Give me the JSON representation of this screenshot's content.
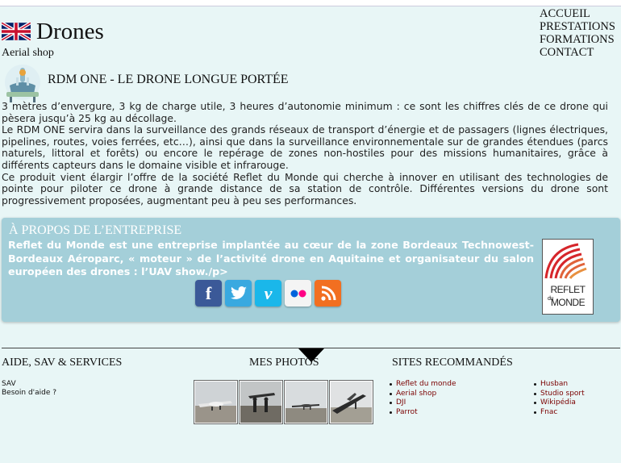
{
  "header": {
    "flag_icon": "uk-flag-icon",
    "title": "Drones",
    "tagline": "Aerial shop"
  },
  "nav": {
    "items": [
      "ACCUEIL",
      "PRESTATIONS",
      "FORMATIONS",
      "CONTACT"
    ]
  },
  "article": {
    "icon": "drone-icon",
    "title": "RDM ONE - LE DRONE LONGUE PORTÉE",
    "paragraphs": [
      "3 mètres d’envergure, 3 kg de charge utile, 3 heures d’autonomie minimum : ce sont les chiffres clés de ce drone qui pèsera jusqu’à 25 kg au décollage.",
      "Le RDM ONE servira dans la surveillance des grands réseaux de transport d’énergie et de passagers (lignes électriques, pipelines, routes, voies ferrées, etc…), ainsi que dans la surveillance environnementale sur de grandes étendues (parcs naturels, littoral et forêts) ou encore le repérage de zones non-hostiles pour des missions humanitaires, grâce à différents capteurs dans le domaine visible et infrarouge.",
      "Ce produit vient élargir l’offre de la société Reflet du Monde qui cherche à innover en utilisant des technologies de pointe pour piloter ce drone à grande distance de sa station de contrôle. Différentes versions du drone sont progressivement proposées, augmentant peu à peu ses performances."
    ]
  },
  "about": {
    "title": "À PROPOS DE L’ENTREPRISE",
    "text": "Reflet du Monde est une entreprise implantée au cœur de la zone Bordeaux Technowest-Bordeaux Aéroparc, « moteur » de l’activité drone en Aquitaine et organisateur du salon européen des drones : l’UAV show./p>",
    "socials": [
      {
        "icon": "facebook-icon",
        "glyph": "f",
        "color": "#3b5998"
      },
      {
        "icon": "twitter-icon",
        "glyph": "🐦",
        "color": "#39a9e0"
      },
      {
        "icon": "vimeo-icon",
        "glyph": "v",
        "color": "#1ab7ea"
      },
      {
        "icon": "flickr-icon",
        "glyph": "●●",
        "color": "#ffffff"
      },
      {
        "icon": "rss-icon",
        "glyph": "))",
        "color": "#f26f21"
      }
    ],
    "logo": {
      "line1": "REFLET",
      "line2": "MONDE",
      "small": "du"
    }
  },
  "footer": {
    "support": {
      "title": "AIDE, SAV & SERVICES",
      "links": [
        "SAV",
        "Besoin d'aide ?"
      ]
    },
    "photos": {
      "title": "MES PHOTOS",
      "count_label": ""
    },
    "sites": {
      "title": "SITES RECOMMANDÉS",
      "col1": [
        "Reflet du monde",
        "Aerial shop",
        "DJI",
        "Parrot"
      ],
      "col2": [
        "Husban",
        "Studio sport",
        "Wikipédia",
        "Fnac"
      ]
    }
  },
  "colors": {
    "page_bg": "#e8f6f6",
    "about_bg": "#a4cfd9",
    "link": "#7a0000"
  }
}
